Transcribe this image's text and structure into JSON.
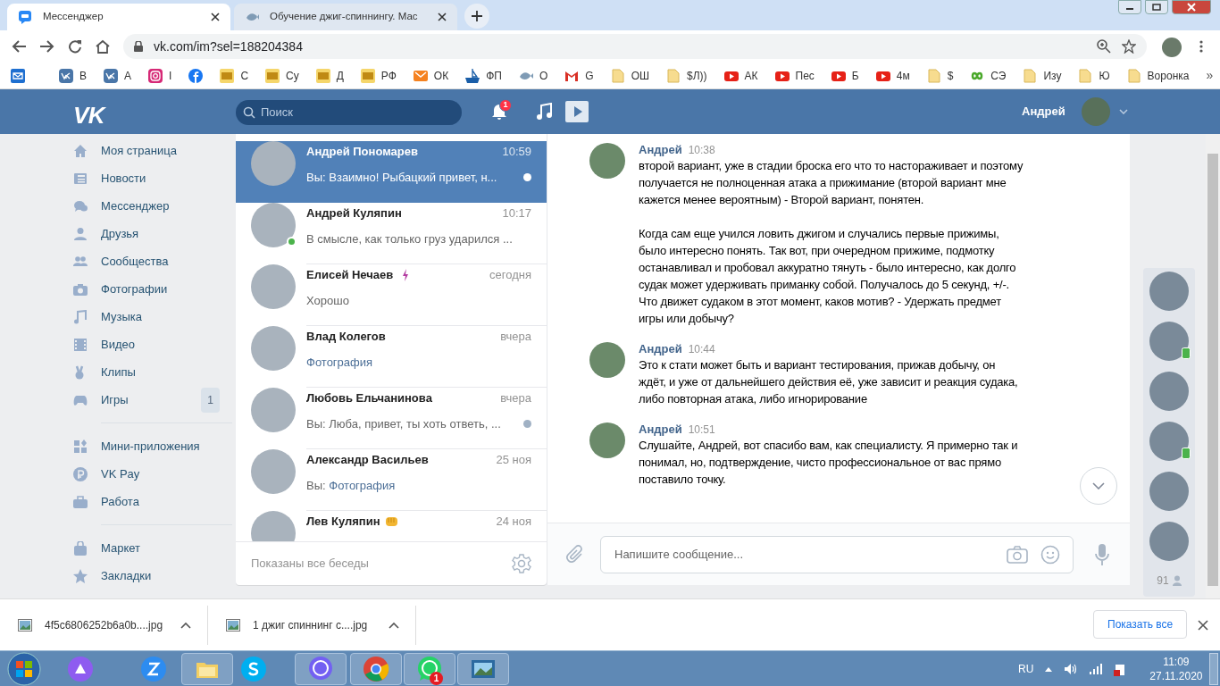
{
  "browser": {
    "tabs": [
      {
        "title": "Мессенджер",
        "kind": "chat",
        "selected": true
      },
      {
        "title": "Обучение джиг-спиннингу. Мас",
        "kind": "fish",
        "selected": false
      }
    ],
    "url": "vk.com/im?sel=188204384",
    "bookmarks": [
      {
        "kind": "mail"
      },
      {
        "label": "В",
        "kind": "vk"
      },
      {
        "label": "А",
        "kind": "vk"
      },
      {
        "label": "I",
        "kind": "instagram"
      },
      {
        "kind": "facebook"
      },
      {
        "label": "С",
        "kind": "rf"
      },
      {
        "label": "Су",
        "kind": "rf"
      },
      {
        "label": "Д",
        "kind": "rf"
      },
      {
        "label": "РФ",
        "kind": "rf"
      },
      {
        "label": "ОК",
        "kind": "envelope"
      },
      {
        "label": "ФП",
        "kind": "ship"
      },
      {
        "label": "О",
        "kind": "fish"
      },
      {
        "label": "G",
        "kind": "gmail"
      },
      {
        "label": "ОШ",
        "kind": "folder"
      },
      {
        "label": "$Л))",
        "kind": "folder"
      },
      {
        "label": "АК",
        "kind": "youtube"
      },
      {
        "label": "Пес",
        "kind": "youtube"
      },
      {
        "label": "Б",
        "kind": "youtube"
      },
      {
        "label": "4м",
        "kind": "youtube"
      },
      {
        "label": "$",
        "kind": "folder"
      },
      {
        "label": "СЭ",
        "kind": "infinity"
      },
      {
        "label": "Изу",
        "kind": "folder"
      },
      {
        "label": "Ю",
        "kind": "folder"
      },
      {
        "label": "Воронка",
        "kind": "folder"
      }
    ],
    "more": "»"
  },
  "header": {
    "logo": "VK",
    "search": {
      "placeholder": "Поиск"
    },
    "notifications": "1",
    "user": "Андрей"
  },
  "sidebar": [
    [
      {
        "label": "Моя страница",
        "kind": "home"
      },
      {
        "label": "Новости",
        "kind": "news"
      },
      {
        "label": "Мессенджер",
        "kind": "chat"
      },
      {
        "label": "Друзья",
        "kind": "person"
      },
      {
        "label": "Сообщества",
        "kind": "people"
      },
      {
        "label": "Фотографии",
        "kind": "camera"
      },
      {
        "label": "Музыка",
        "kind": "music"
      },
      {
        "label": "Видео",
        "kind": "video"
      },
      {
        "label": "Клипы",
        "kind": "clips"
      },
      {
        "label": "Игры",
        "kind": "gamepad",
        "badge": "1"
      }
    ],
    [
      {
        "label": "Мини-приложения",
        "kind": "apps"
      },
      {
        "label": "VK Pay",
        "kind": "ruble"
      },
      {
        "label": "Работа",
        "kind": "briefcase"
      }
    ],
    [
      {
        "label": "Маркет",
        "kind": "bag"
      },
      {
        "label": "Закладки",
        "kind": "star"
      }
    ]
  ],
  "conversations": [
    {
      "name": "Андрей Пономарев",
      "kind": "plain",
      "time": "10:59",
      "sender": "Вы:",
      "preview": "Взаимно! Рыбацкий привет, н...",
      "attachment": false,
      "selected": true,
      "online": false,
      "unread": true
    },
    {
      "name": "Андрей Куляпин",
      "kind": "plain",
      "time": "10:17",
      "preview": "В смысле, как только груз ударился ...",
      "attachment": false,
      "selected": false,
      "online": true,
      "unread": false
    },
    {
      "name": "Елисей Нечаев",
      "kind": "lightning",
      "time": "сегодня",
      "preview": "Хорошо",
      "attachment": false,
      "selected": false,
      "online": false,
      "unread": false
    },
    {
      "name": "Влад Колегов",
      "kind": "plain",
      "time": "вчера",
      "preview": "Фотография",
      "attachment": true,
      "selected": false,
      "online": false,
      "unread": false
    },
    {
      "name": "Любовь Ельчанинова",
      "kind": "plain",
      "time": "вчера",
      "sender": "Вы:",
      "preview": "Люба, привет, ты хоть ответь, ...",
      "attachment": false,
      "selected": false,
      "online": false,
      "unread": true
    },
    {
      "name": "Александр Васильев",
      "kind": "plain",
      "time": "25 ноя",
      "sender": "Вы:",
      "preview": "Фотография",
      "attachment": true,
      "selected": false,
      "online": false,
      "unread": false
    },
    {
      "name": "Лев Куляпин",
      "kind": "fist",
      "time": "24 ноя",
      "selected": false,
      "online": false
    }
  ],
  "conversations_footer": "Показаны все беседы",
  "messages": [
    {
      "author": "Андрей",
      "time": "10:38",
      "paragraphs": [
        "второй вариант, уже в стадии броска его что то настораживает и поэтому получается не полноценная атака а прижимание (второй вариант мне кажется менее вероятным) - Второй вариант, понятен.",
        "Когда сам еще учился ловить джигом и случались первые прижимы, было интересно понять. Так вот, при очередном прижиме, подмотку останавливал и пробовал аккуратно тянуть - было интересно, как долго судак может удерживать приманку собой. Получалось до 5 секунд, +/-. Что движет судаком в этот момент, каков мотив? - Удержать предмет игры или добычу?"
      ]
    },
    {
      "author": "Андрей",
      "time": "10:44",
      "paragraphs": [
        "Это к стати может быть и вариант тестирования, прижав добычу, он ждёт, и уже от дальнейшего действия её, уже зависит и реакция судака, либо повторная атака, либо игнорирование"
      ]
    },
    {
      "author": "Андрей",
      "time": "10:51",
      "paragraphs": [
        "Слушайте, Андрей, вот спасибо вам, как специалисту. Я примерно так и понимал, но, подтверждение, чисто профессиональное от вас прямо поставило точку."
      ]
    }
  ],
  "composer": {
    "placeholder": "Напишите сообщение..."
  },
  "online_friends": [
    {
      "online": false
    },
    {
      "online": true
    },
    {
      "online": false
    },
    {
      "online": true
    },
    {
      "online": false
    },
    {
      "online": false
    }
  ],
  "online_count": "91",
  "downloads": [
    {
      "name": "4f5c6806252b6a0b....jpg"
    },
    {
      "name": "1 джиг спиннинг с....jpg"
    }
  ],
  "show_all": "Показать все",
  "taskbar": {
    "apps": [
      {
        "kind": "alice"
      },
      {
        "kind": "zoom"
      },
      {
        "kind": "folder"
      },
      {
        "kind": "skype"
      },
      {
        "kind": "viber"
      },
      {
        "kind": "chrome"
      },
      {
        "kind": "whatsapp",
        "badge": "1"
      },
      {
        "kind": "photos"
      }
    ],
    "language": "RU",
    "time": "11:09",
    "date": "27.11.2020"
  }
}
